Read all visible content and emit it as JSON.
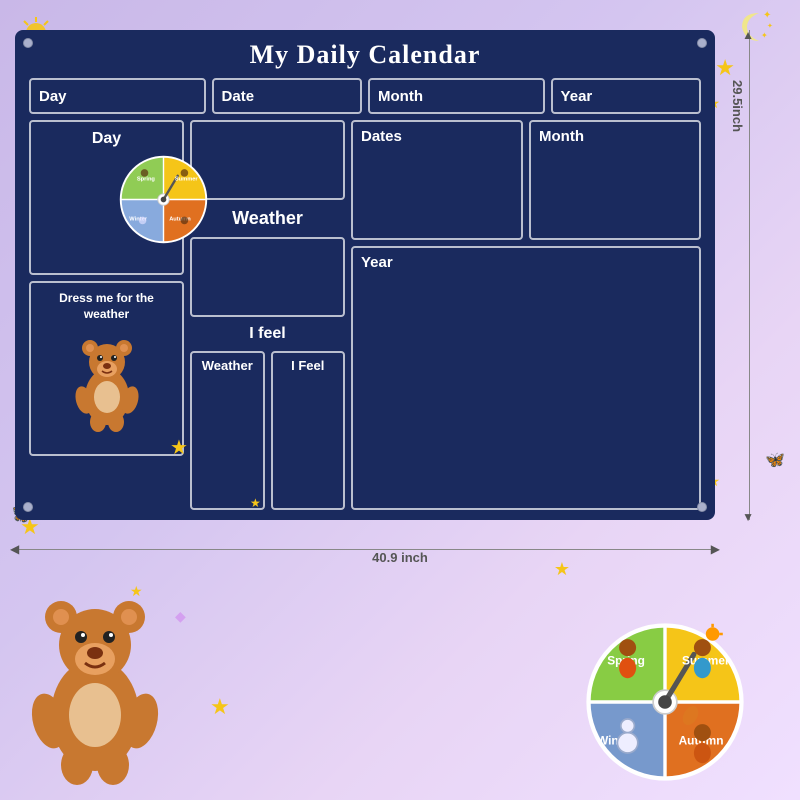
{
  "title": "My Daily Calendar",
  "board": {
    "row1": {
      "labels": [
        "Day",
        "Date",
        "Month",
        "Year"
      ]
    },
    "row2_left": {
      "day_label": "Day",
      "dress_label": "Dress me for the weather"
    },
    "row2_center": {
      "weather_label": "Weather",
      "ifeel_label": "I feel",
      "weather_small": "Weather",
      "ifeel_small": "I Feel"
    },
    "row2_right": {
      "dates_label": "Dates",
      "month_label": "Month",
      "year_label": "Year"
    }
  },
  "dimensions": {
    "width": "40.9 inch",
    "height": "29.5inch"
  },
  "seasons": {
    "spring": "Spring",
    "summer": "Summer",
    "autumn": "Autumn",
    "winter": "Winter"
  }
}
